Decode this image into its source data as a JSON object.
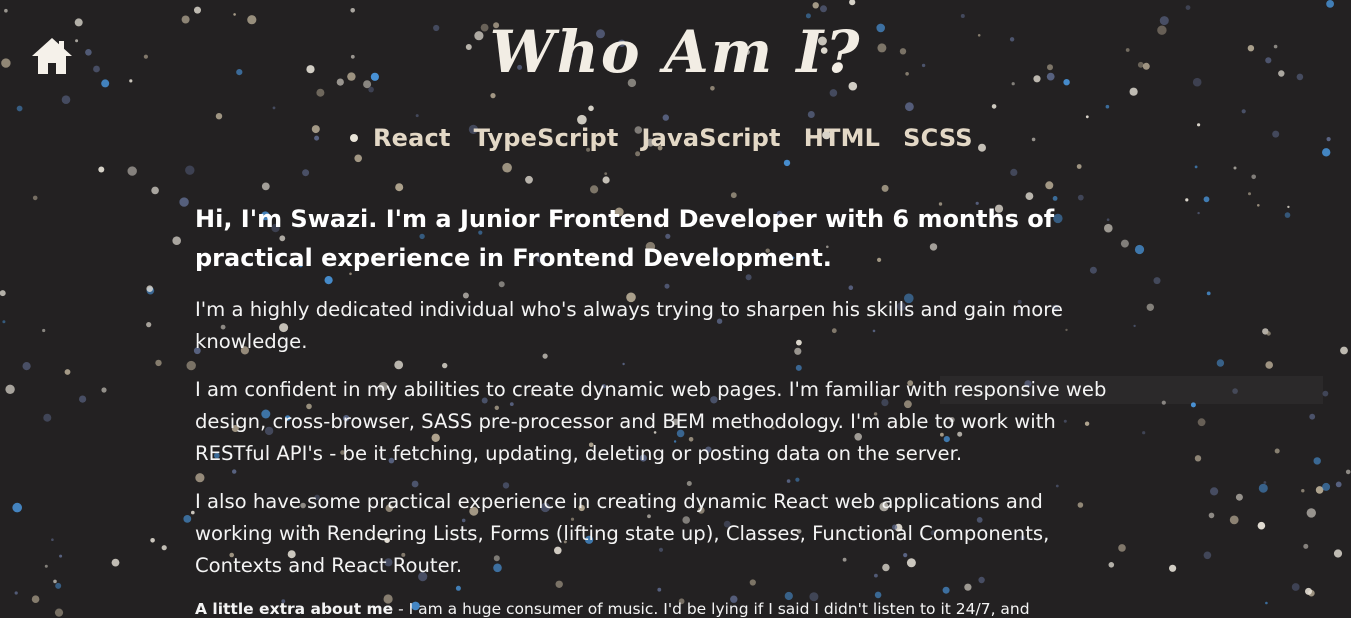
{
  "colors": {
    "background": "#232122",
    "title": "#f2ede4",
    "skills_text": "#e3d8c6",
    "body_text": "#f4f4f4",
    "star_white": "#ece7dc",
    "star_blue": "#4a98e0",
    "star_slate": "#5c6788",
    "star_tan": "#b7ab95"
  },
  "nav": {
    "home_icon": "home-icon"
  },
  "header": {
    "title": "Who Am I?"
  },
  "skills": [
    "React",
    "TypeScript",
    "JavaScript",
    "HTML",
    "SCSS"
  ],
  "about": {
    "intro": "Hi, I'm Swazi. I'm a Junior Frontend Developer with 6 months of practical experience in Frontend Development.",
    "paragraphs": [
      "I'm a highly dedicated individual who's always trying to sharpen his skills and gain more knowledge.",
      "I am confident in my abilities to create dynamic web pages. I'm familiar with responsive web design, cross-browser, SASS pre-processor and BEM methodology. I'm able to work with RESTful API's - be it fetching, updating, deleting or posting data on the server.",
      "I also have some practical experience in creating dynamic React web applications and working with Rendering Lists, Forms (lifting state up), Classes, Functional Components, Contexts and React Router."
    ],
    "extra_label": "A little extra about me",
    "extra_text": " - I am a huge consumer of music. I'd be lying if I said I didn't listen to it 24/7, and"
  }
}
